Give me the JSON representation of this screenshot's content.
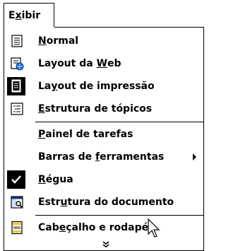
{
  "menu": {
    "title_pre": "E",
    "title_ul": "x",
    "title_post": "ibir",
    "items": [
      {
        "pre": "",
        "ul": "N",
        "post": "ormal",
        "icon": "normal-view-icon"
      },
      {
        "pre": "Layout da ",
        "ul": "W",
        "post": "eb",
        "icon": "web-layout-icon"
      },
      {
        "pre": "La",
        "ul": "y",
        "post": "out de impressão",
        "icon": "print-layout-icon",
        "selected": true
      },
      {
        "pre": "",
        "ul": "E",
        "post": "strutura de tópicos",
        "icon": "outline-view-icon"
      },
      {
        "pre": "",
        "ul": "P",
        "post": "ainel de tarefas",
        "icon": ""
      },
      {
        "pre": "Barras de ",
        "ul": "f",
        "post": "erramentas",
        "icon": "",
        "submenu": true
      },
      {
        "pre": "",
        "ul": "R",
        "post": "égua",
        "icon": "checkmark-icon",
        "checked": true
      },
      {
        "pre": "Estr",
        "ul": "u",
        "post": "tura do documento",
        "icon": "document-map-icon"
      },
      {
        "pre": "Cab",
        "ul": "e",
        "post": "çalho e rodapé",
        "icon": "header-footer-icon"
      }
    ],
    "expand_glyph": "»"
  }
}
